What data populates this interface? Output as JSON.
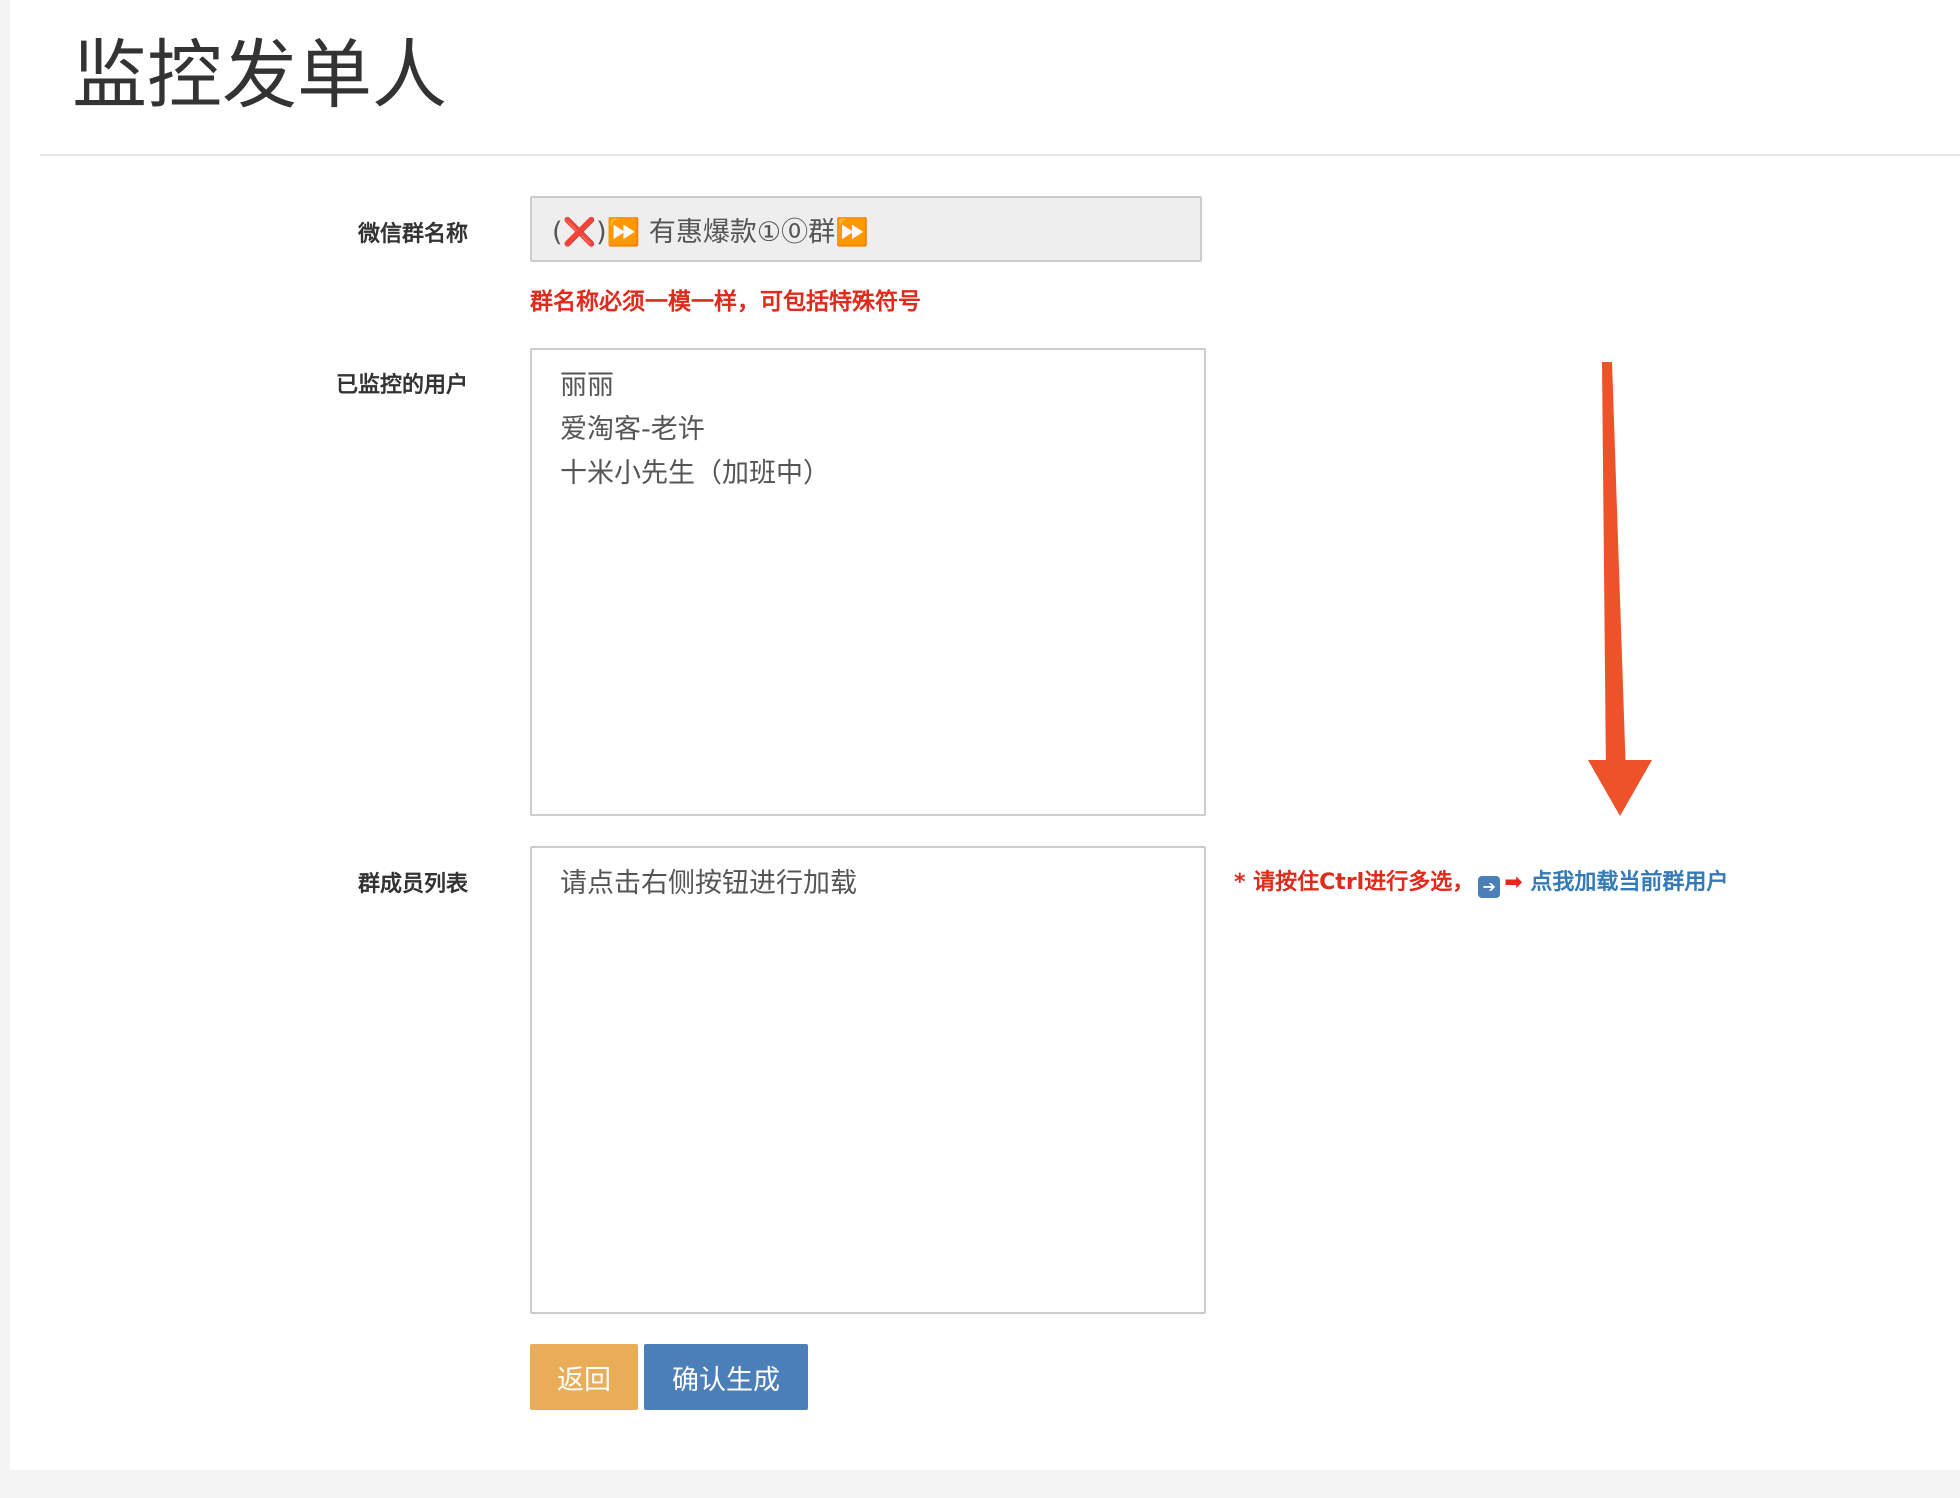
{
  "page": {
    "title": "监控发单人"
  },
  "form": {
    "group_name": {
      "label": "微信群名称",
      "value": "(❌)⏩ 有惠爆款①⓪群⏩",
      "hint": "群名称必须一模一样，可包括特殊符号"
    },
    "monitored_users": {
      "label": "已监控的用户",
      "items": [
        "丽丽",
        "爱淘客-老许",
        "十米小先生（加班中）"
      ]
    },
    "group_members": {
      "label": "群成员列表",
      "items": [
        "请点击右侧按钮进行加载"
      ],
      "note_prefix": "* 请按住Ctrl进行多选，",
      "note_arrow": "➡",
      "load_link": "点我加载当前群用户"
    }
  },
  "buttons": {
    "back": "返回",
    "confirm": "确认生成"
  },
  "colors": {
    "hint_red": "#e02a1c",
    "link_blue": "#337ab7",
    "back_button": "#e8ad56",
    "confirm_button": "#4a7fb8",
    "arrow_orange": "#ee5228"
  },
  "icons": {
    "arrow": "arrow-down-icon",
    "square_arrow": "square-right-arrow-icon"
  }
}
